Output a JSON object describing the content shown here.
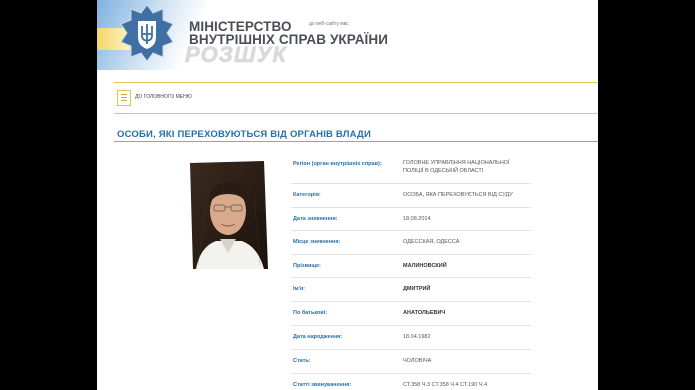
{
  "header": {
    "ministry_line1": "МІНІСТЕРСТВО",
    "ministry_line2": "ВНУТРІШНІХ СПРАВ УКРАЇНИ",
    "section": "РОЗШУК",
    "old_site_link": "до веб-сайту мвс"
  },
  "menu": {
    "home_label": "ДО ГОЛОВНОГО МЕНЮ",
    "icon": "list-icon"
  },
  "page_title": "ОСОБИ, ЯКІ ПЕРЕХОВУЮТЬСЯ ВІД ОРГАНІВ ВЛАДИ",
  "details": [
    {
      "label": "Регіон (орган внутрішніх справ):",
      "value_line1": "ГОЛОВНЕ УПРАВЛІННЯ НАЦІОНАЛЬНОЇ",
      "value_line2": "ПОЛІЦІЇ В ОДЕСЬКІЙ ОБЛАСТІ"
    },
    {
      "label": "Категорія:",
      "value_line1": "ОСОБА, ЯКА ПЕРЕХОВУЄТЬСЯ ВІД СУДУ"
    },
    {
      "label": "Дата зникнення:",
      "value_line1": "18.08.2014"
    },
    {
      "label": "Місце зникнення:",
      "value_line1": "ОДЕССКАЯ, ОДЕССА"
    },
    {
      "label": "Прізвище:",
      "value_line1": "МАЛИНОВСКИЙ"
    },
    {
      "label": "Ім'я:",
      "value_line1": "ДМИТРИЙ"
    },
    {
      "label": "По батькові:",
      "value_line1": "АНАТОЛЬЕВИЧ"
    },
    {
      "label": "Дата народження:",
      "value_line1": "18.04.1982"
    },
    {
      "label": "Стать:",
      "value_line1": "ЧОЛОВІЧА"
    },
    {
      "label": "Статті звинувачення:",
      "value_line1": "СТ.358 Ч.3 СТ.358 Ч.4 СТ.190 Ч.4"
    }
  ],
  "colors": {
    "accent_blue": "#2a6fa8",
    "gold": "#e6c95a",
    "flag_blue": "#7fb2e0"
  }
}
